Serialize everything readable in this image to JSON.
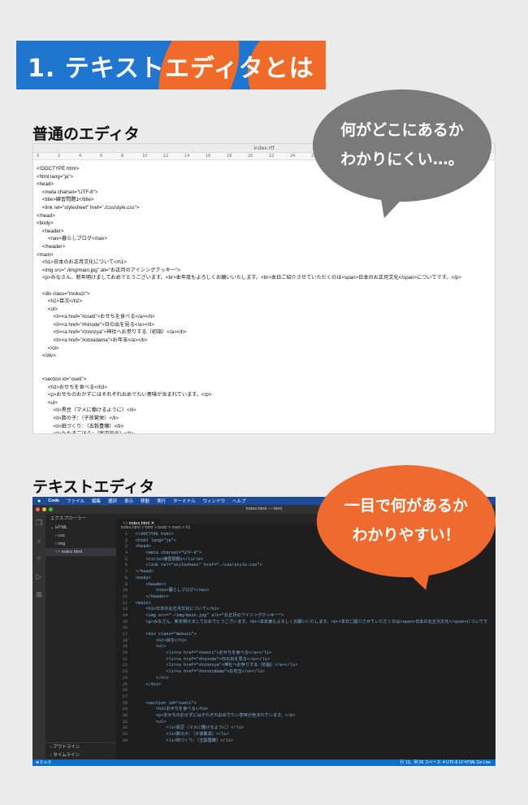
{
  "section": {
    "title": "1. テキストエディタとは"
  },
  "headings": {
    "plain": "普通のエディタ",
    "vscode": "テキストエディタ"
  },
  "bubbles": {
    "gray": [
      "何がどこにあるか",
      "わかりにくい…。"
    ],
    "orange": [
      "一目で何があるか",
      "わかりやすい！"
    ]
  },
  "colors": {
    "blue": "#2075cf",
    "orange": "#f06a2a",
    "bubble_gray": "#7a7a7a"
  },
  "plain_editor": {
    "filename": "index.rtf",
    "ruler": [
      "0",
      "2",
      "4",
      "6",
      "8",
      "10",
      "12",
      "14",
      "16",
      "18",
      "20",
      "22",
      "24",
      "26",
      "28"
    ],
    "lines": [
      "<!DOCTYPE html>",
      "<html lang=\"ja\">",
      "<head>",
      "    <meta charset=\"UTF-8\">",
      "    <title>練習問題1</title>",
      "    <link rel=\"stylesheet\" href=\"./css/style.css\">",
      "</head>",
      "<body>",
      "    <header>",
      "        <nav>暮らしブログ</nav>",
      "    </header>",
      "<main>",
      "    <h1>日本のお正月文化について</h1>",
      "    <img src=\"./img/main.jpg\" alt=\"お正月のアイシングクッキー\">",
      "    <p>みなさん、新年明けましておめでとうございます。<br>本年度もよろしくお願いいたします。<br>本日ご紹介させていただくのは<span>日本のお正月文化</span>についてです。</p>",
      "",
      "    <div class=\"mokuzi\">",
      "        <h2>目次</h2>",
      "        <ol>",
      "            <li><a href=\"#oseti\">おせちを食べる</a></li>",
      "            <li><a href=\"#hinode\">日の出を見る</a></li>",
      "            <li><a href=\"#zinnzya\">神社へお参りする（初詣）</a></li>",
      "            <li><a href=\"#otosidama\">お年玉</a></li>",
      "        </ol>",
      "    </div>",
      "",
      "",
      "    <section id=\"oseti\">",
      "        <h3>おせちを食べる</h3>",
      "        <p>おせちのおかずにはそれぞれおめでたい意味が含まれています。</p>",
      "        <ul>",
      "            <li>黒豆（マメに働けるように）</li>",
      "            <li>数の子：（子孫繁栄）</li>",
      "            <li>田づくり：（五穀豊穣）</li>",
      "            <li>たたきごぼう：（家内安全）</li>"
    ]
  },
  "vscode": {
    "menu": [
      "Code",
      "ファイル",
      "編集",
      "選択",
      "表示",
      "移動",
      "実行",
      "ターミナル",
      "ウィンドウ",
      "ヘルプ"
    ],
    "window_title": "index.html — html",
    "explorer_title": "エクスプローラー",
    "tree": [
      "HTML",
      "css",
      "img",
      "index.html"
    ],
    "outline": "アウトライン",
    "timeline": "タイムライン",
    "tab": "index.html",
    "breadcrumb": "index.html > html > body > main > h1",
    "lines": [
      {
        "n": "1",
        "t": "<!DOCTYPE html>"
      },
      {
        "n": "2",
        "t": "<html lang=\"ja\">"
      },
      {
        "n": "3",
        "t": "<head>"
      },
      {
        "n": "4",
        "t": "    <meta charset=\"UTF-8\">"
      },
      {
        "n": "5",
        "t": "    <title>練習問題1</title>"
      },
      {
        "n": "6",
        "t": "    <link rel=\"stylesheet\" href=\"./css/style.css\">"
      },
      {
        "n": "7",
        "t": "</head>"
      },
      {
        "n": "8",
        "t": "<body>"
      },
      {
        "n": "9",
        "t": "    <header>"
      },
      {
        "n": "10",
        "t": "        <nav>暮らしブログ</nav>"
      },
      {
        "n": "11",
        "t": "    </header>"
      },
      {
        "n": "12",
        "t": "<main>"
      },
      {
        "n": "13",
        "t": "    <h1>日本のお正月文化について</h1>"
      },
      {
        "n": "14",
        "t": "    <img src=\"./img/main.jpg\" alt=\"お正月のアイシングクッキー\">"
      },
      {
        "n": "15",
        "t": "    <p>みなさん、新年明けましておめでとうございます。<br>本年度もよろしくお願いいたします。<br>本日ご紹介させていただくのは<span>日本のお正月文化</span>についてで"
      },
      {
        "n": "16",
        "t": ""
      },
      {
        "n": "17",
        "t": "    <div class=\"mokuzi\">"
      },
      {
        "n": "18",
        "t": "        <h2>目次</h2>"
      },
      {
        "n": "19",
        "t": "        <ol>"
      },
      {
        "n": "20",
        "t": "            <li><a href=\"#oseti\">おせちを食べる</a></li>"
      },
      {
        "n": "21",
        "t": "            <li><a href=\"#hinode\">日の出を見る</a></li>"
      },
      {
        "n": "22",
        "t": "            <li><a href=\"#zinnzya\">神社へお参りする（初詣）</a></li>"
      },
      {
        "n": "23",
        "t": "            <li><a href=\"#otosidama\">お年玉</a></li>"
      },
      {
        "n": "24",
        "t": "        </ol>"
      },
      {
        "n": "25",
        "t": "    </div>"
      },
      {
        "n": "26",
        "t": ""
      },
      {
        "n": "27",
        "t": ""
      },
      {
        "n": "28",
        "t": "    <section id=\"oseti\">"
      },
      {
        "n": "29",
        "t": "        <h3>おせちを食べる</h3>"
      },
      {
        "n": "30",
        "t": "        <p>おせちのおかずにはそれぞれおめでたい意味が含まれています。</p>"
      },
      {
        "n": "31",
        "t": "        <ul>"
      },
      {
        "n": "32",
        "t": "            <li>黒豆（マメに働けるように）</li>"
      },
      {
        "n": "33",
        "t": "            <li>数の子：（子孫繁栄）</li>"
      },
      {
        "n": "34",
        "t": "            <li>田づくり：（五穀豊穣）</li>"
      }
    ],
    "status_left": "⊗ 0 ⚠ 0",
    "status_right": "行 13、列 26   スペース: 4   UTF-8   LF   HTML   Go Live"
  }
}
